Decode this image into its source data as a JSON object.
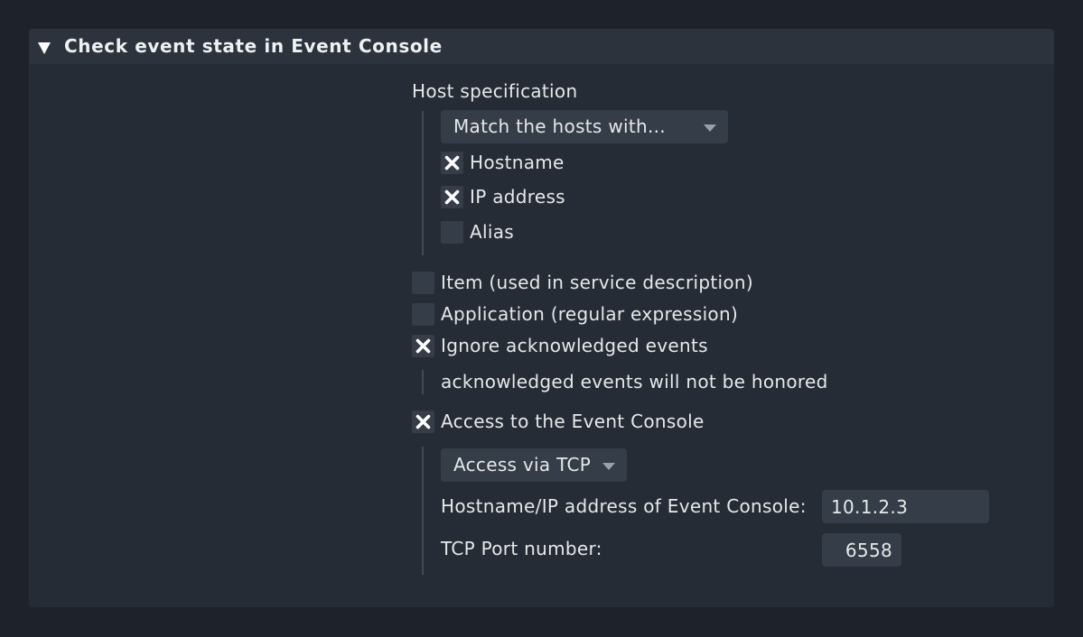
{
  "panel": {
    "title": "Check event state in Event Console"
  },
  "host_spec": {
    "label": "Host specification",
    "match_select": "Match the hosts with...",
    "options": [
      {
        "label": "Hostname",
        "checked": true
      },
      {
        "label": "IP address",
        "checked": true
      },
      {
        "label": "Alias",
        "checked": false
      }
    ]
  },
  "item_option": {
    "label": "Item (used in service description)",
    "checked": false
  },
  "application_option": {
    "label": "Application (regular expression)",
    "checked": false
  },
  "ignore_ack": {
    "label": "Ignore acknowledged events",
    "checked": true,
    "description": "acknowledged events will not be honored"
  },
  "access": {
    "label": "Access to the Event Console",
    "checked": true,
    "method_select": "Access via TCP",
    "host_label": "Hostname/IP address of Event Console:",
    "host_value": "10.1.2.3",
    "port_label": "TCP Port number:",
    "port_value": "6558"
  },
  "icons": {
    "collapse": "triangle-down-icon",
    "check": "cross-mark-icon",
    "dropdown": "caret-down-icon"
  }
}
